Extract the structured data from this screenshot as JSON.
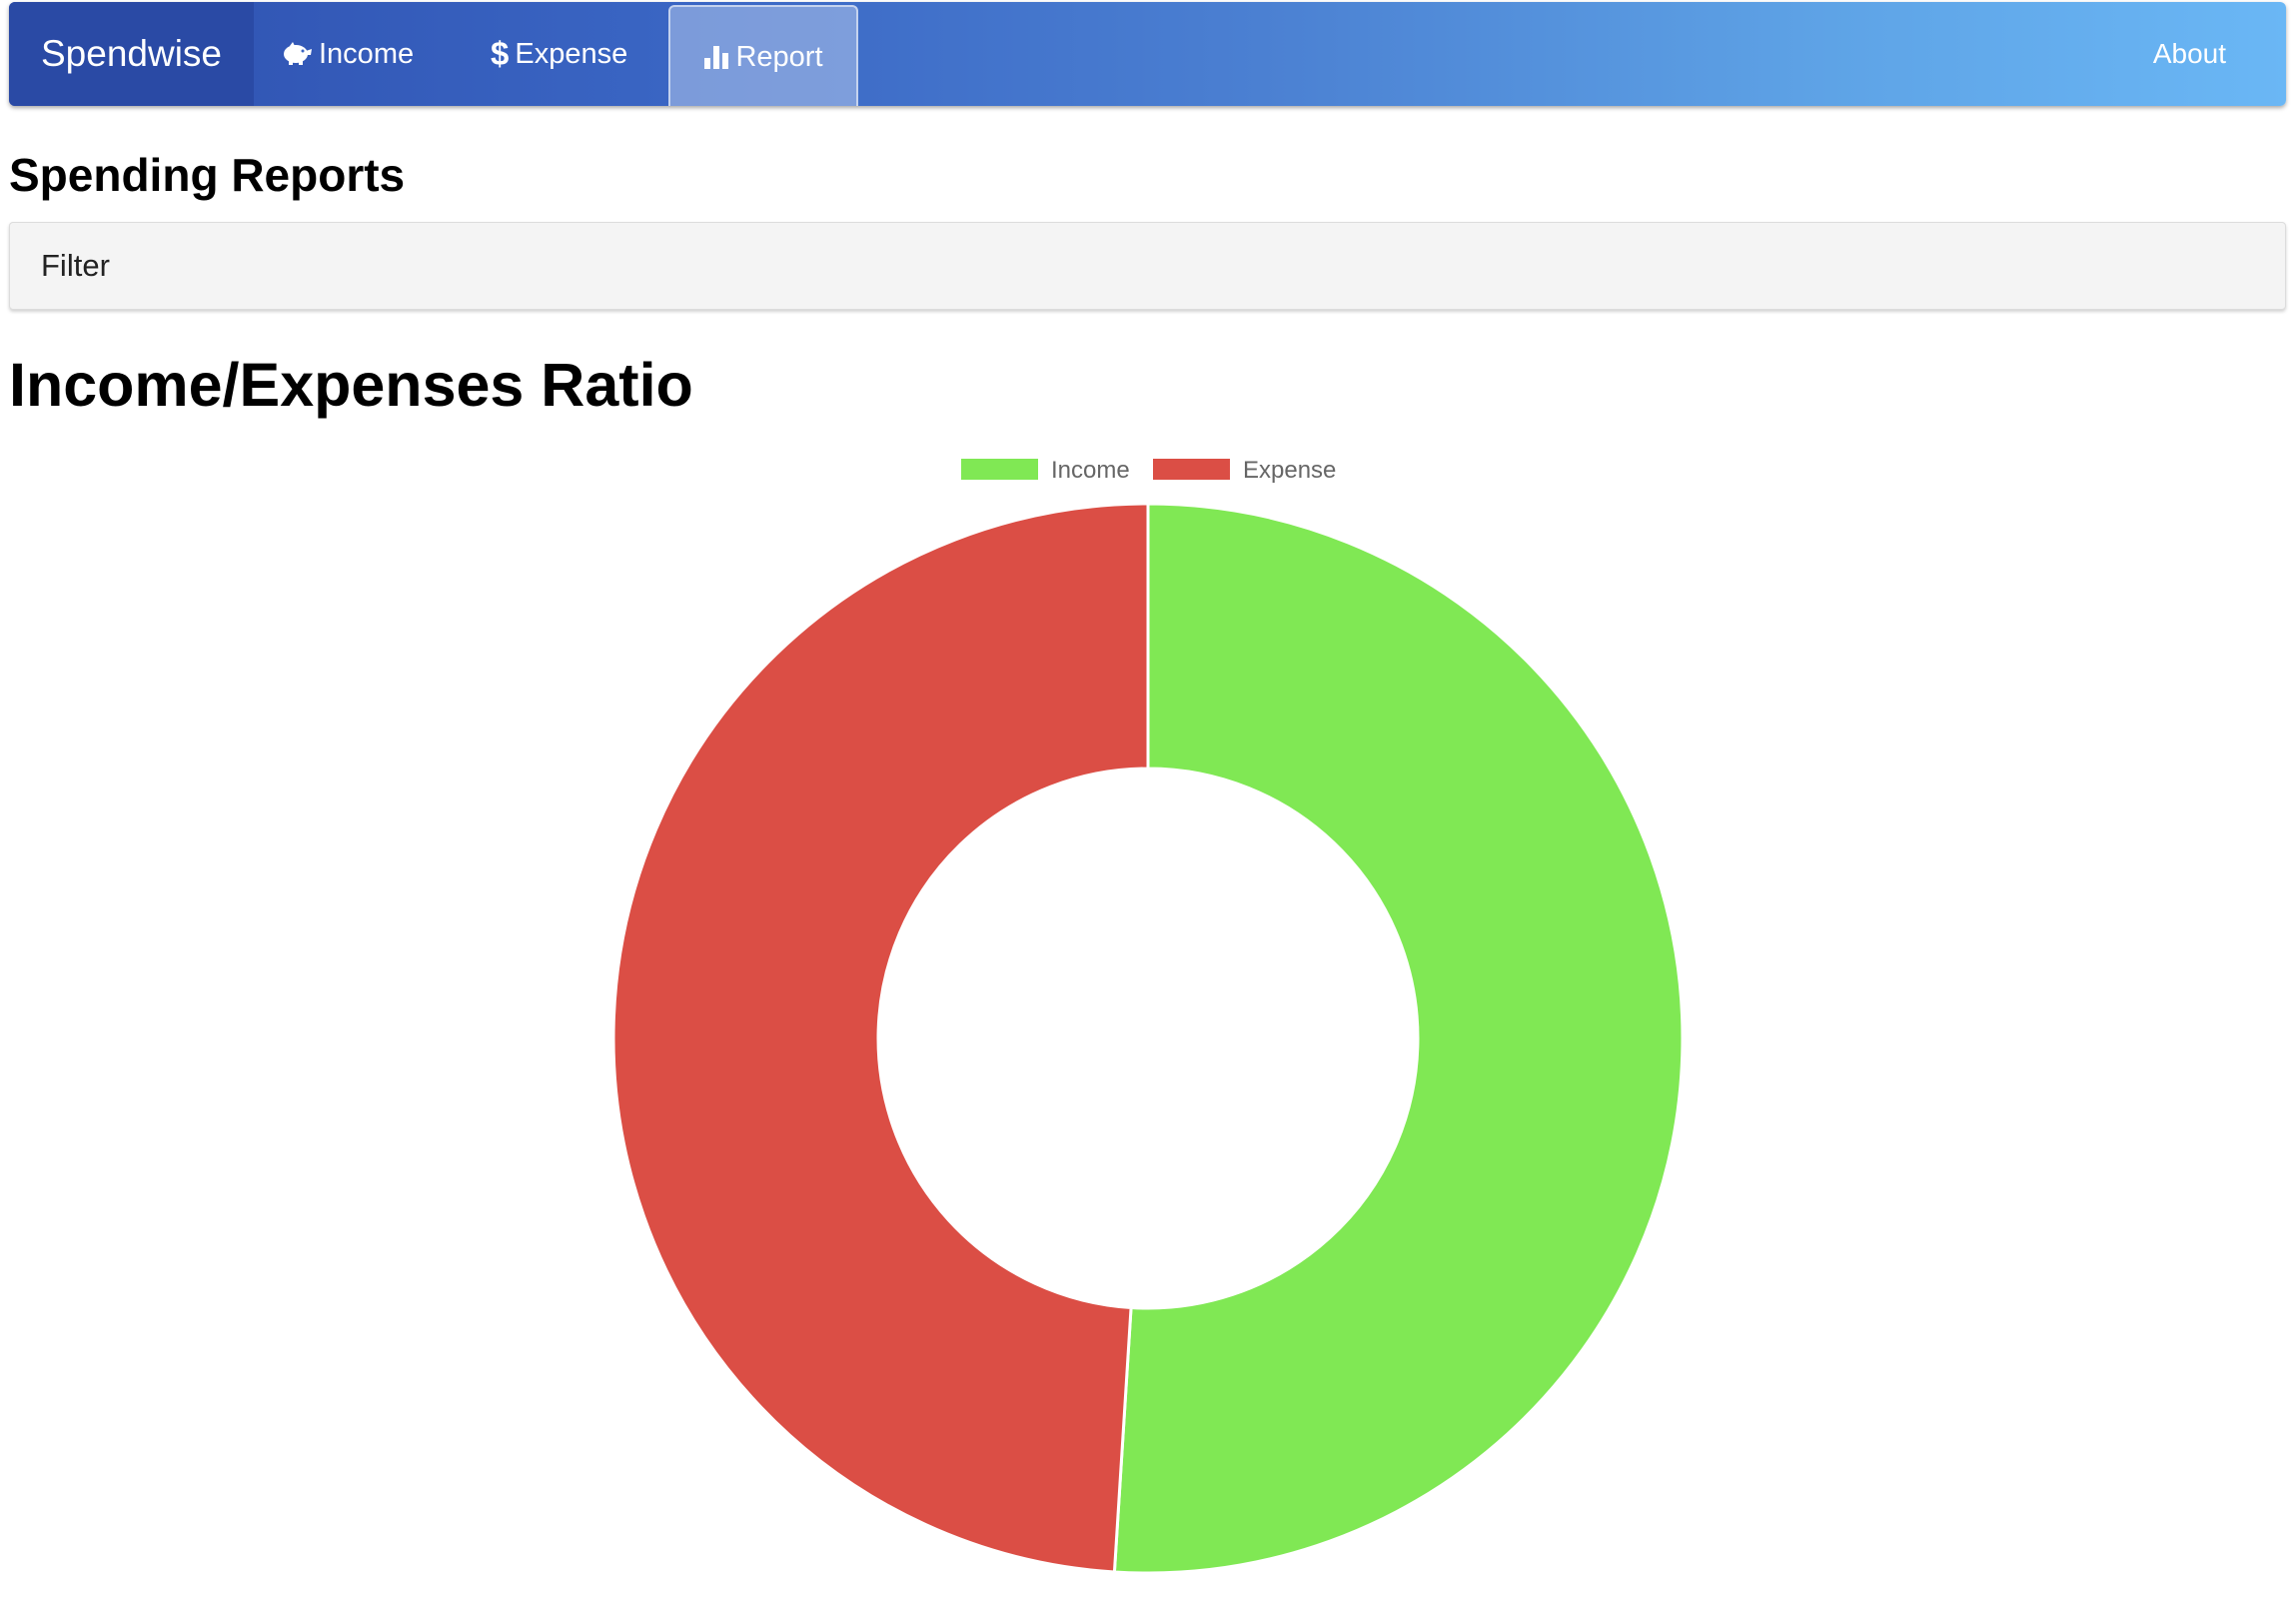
{
  "app": {
    "brand": "Spendwise"
  },
  "nav": {
    "items": [
      {
        "label": "Income",
        "icon": "piggy-bank-icon"
      },
      {
        "label": "Expense",
        "icon": "dollar-icon"
      },
      {
        "label": "Report",
        "icon": "bar-chart-icon",
        "active": true
      }
    ],
    "about_label": "About"
  },
  "page": {
    "title": "Spending Reports",
    "filter_label": "Filter"
  },
  "chart": {
    "title": "Income/Expenses Ratio"
  },
  "colors": {
    "income": "#80e854",
    "expense": "#db4e45"
  },
  "chart_data": {
    "type": "pie",
    "variant": "doughnut",
    "legend_position": "top",
    "labels": [
      "Income",
      "Expense"
    ],
    "values": [
      51,
      49
    ]
  }
}
